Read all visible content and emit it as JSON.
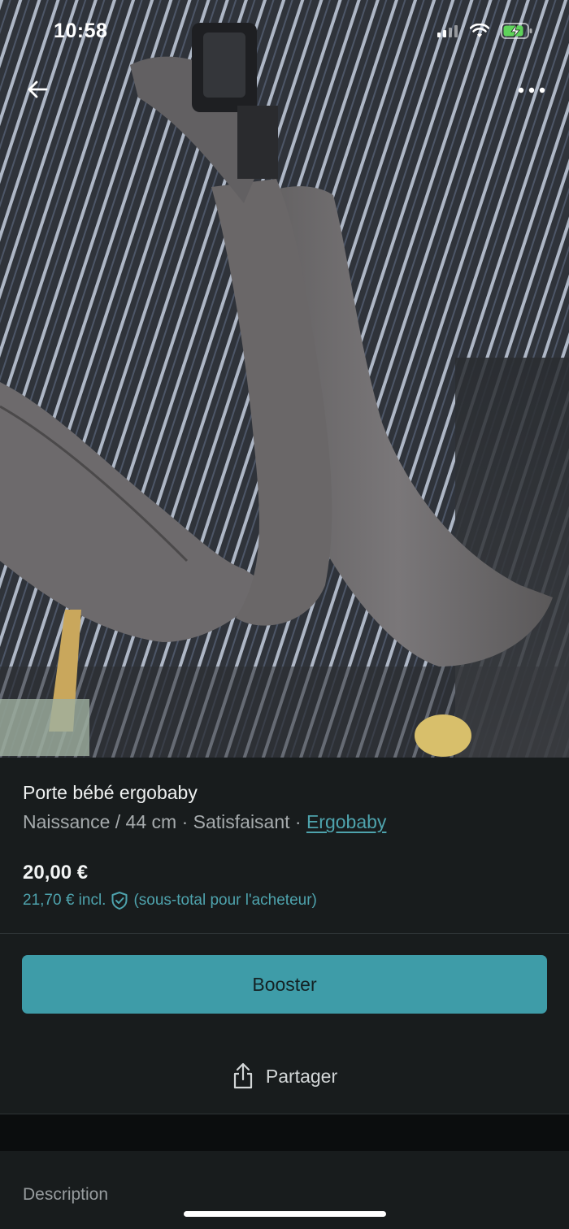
{
  "status_bar": {
    "time": "10:58",
    "icons": [
      "cellular-signal-icon",
      "wifi-icon",
      "battery-charging-icon"
    ]
  },
  "nav": {
    "back_icon": "arrow-left-icon",
    "more_icon": "more-horizontal-icon"
  },
  "item": {
    "title": "Porte bébé ergobaby",
    "details_prefix": "Naissance / 44 cm · Satisfaisant · ",
    "brand": "Ergobaby",
    "price": "20,00 €",
    "price_incl": "21,70 € incl.",
    "price_incl_note": "(sous-total pour l'acheteur)",
    "protection_icon": "shield-check-icon"
  },
  "actions": {
    "booster_label": "Booster",
    "share_label": "Partager",
    "share_icon": "share-icon"
  },
  "description": {
    "label": "Description"
  },
  "colors": {
    "accent": "#3e9ca8",
    "link": "#4ea3ad",
    "background": "#181c1d"
  }
}
